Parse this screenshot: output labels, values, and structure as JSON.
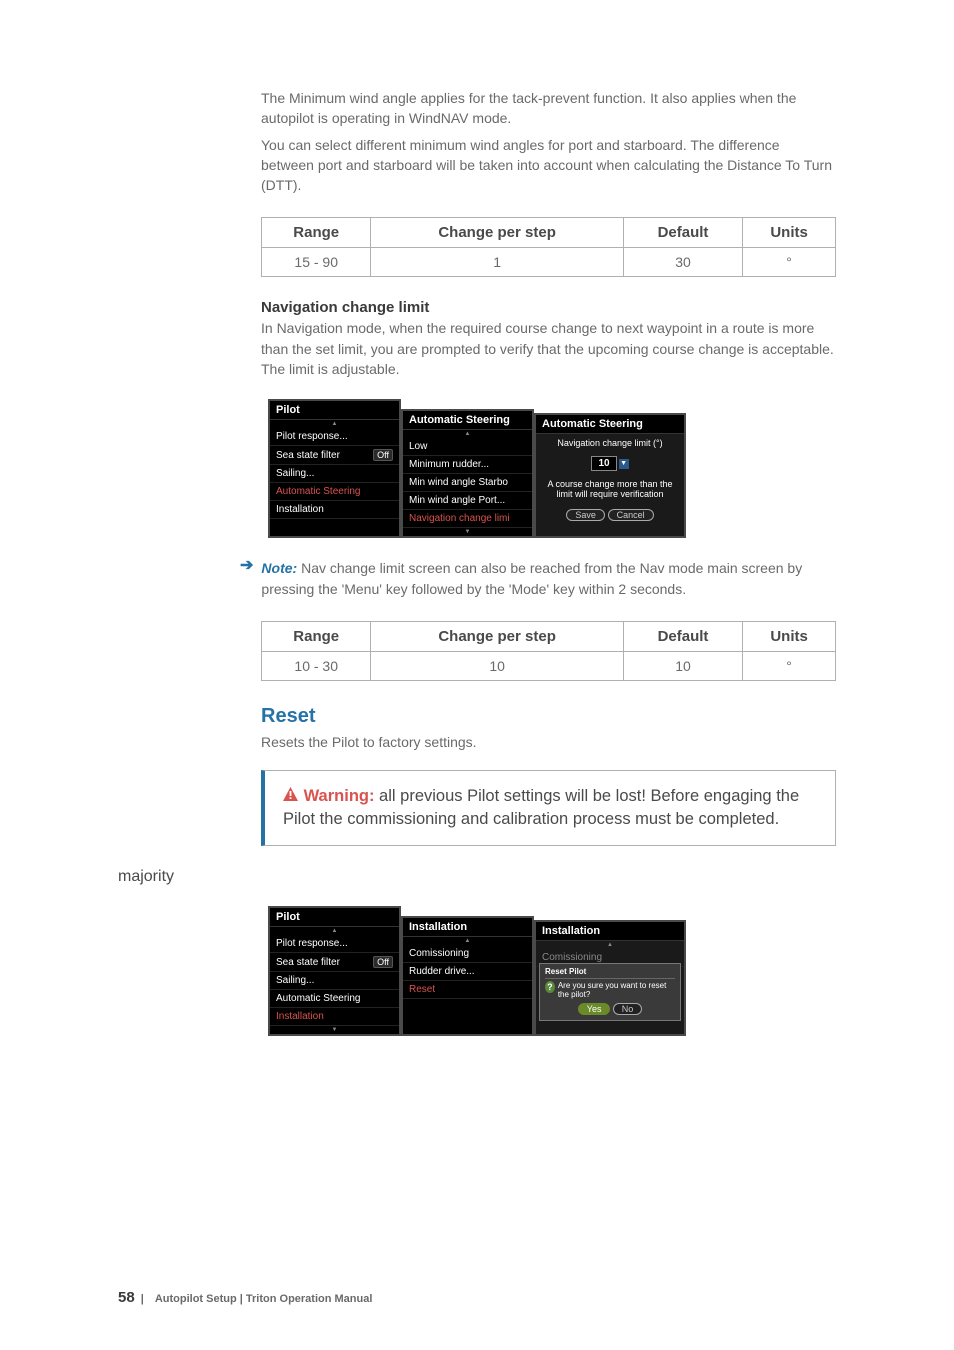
{
  "intro": {
    "p1": "The Minimum wind angle applies for the tack-prevent function. It also applies when the autopilot is operating in WindNAV mode.",
    "p2": "You can select different minimum wind angles for port and starboard. The difference between port and starboard will be taken into account when calculating the Distance To Turn (DTT)."
  },
  "table1": {
    "headers": {
      "range": "Range",
      "cps": "Change per step",
      "default": "Default",
      "units": "Units"
    },
    "row": {
      "range": "15 - 90",
      "cps": "1",
      "default": "30",
      "units": "°"
    }
  },
  "nav_limit": {
    "heading": "Navigation change limit",
    "p1": "In Navigation mode, when the required course change to next waypoint in a route is more than the set limit, you are prompted to verify that the upcoming course change is acceptable. The limit is adjustable."
  },
  "fig1": {
    "panelA": {
      "title": "Pilot",
      "items": [
        {
          "label": "Pilot response...",
          "badge": ""
        },
        {
          "label": "Sea state filter",
          "badge": "Off"
        },
        {
          "label": "Sailing...",
          "badge": ""
        },
        {
          "label": "Automatic Steering",
          "badge": "",
          "selected": true
        },
        {
          "label": "Installation",
          "badge": ""
        }
      ]
    },
    "panelB": {
      "title": "Automatic Steering",
      "items": [
        {
          "label": "Low"
        },
        {
          "label": "Minimum rudder..."
        },
        {
          "label": "Min wind angle Starbo"
        },
        {
          "label": "Min wind angle Port..."
        },
        {
          "label": "Navigation change limi",
          "selected": true
        }
      ]
    },
    "panelC": {
      "title": "Automatic Steering",
      "label": "Navigation change limit (°)",
      "value": "10",
      "hint": "A course change more than the limit will require verification",
      "save": "Save",
      "cancel": "Cancel"
    }
  },
  "note1": {
    "label": "Note:",
    "text": " Nav change limit screen can also be reached from the Nav mode main screen by pressing the 'Menu' key followed by the 'Mode' key within 2 seconds."
  },
  "table2": {
    "headers": {
      "range": "Range",
      "cps": "Change per step",
      "default": "Default",
      "units": "Units"
    },
    "row": {
      "range": "10 - 30",
      "cps": "10",
      "default": "10",
      "units": "°"
    }
  },
  "reset": {
    "heading": "Reset",
    "p1": "Resets the Pilot to factory settings."
  },
  "warning": {
    "label": "Warning:",
    "text": " all previous Pilot settings will be lost! Before engaging the Pilot the commissioning and calibration process must be completed."
  },
  "fig2": {
    "panelA": {
      "title": "Pilot",
      "items": [
        {
          "label": "Pilot response...",
          "badge": ""
        },
        {
          "label": "Sea state filter",
          "badge": "Off"
        },
        {
          "label": "Sailing...",
          "badge": ""
        },
        {
          "label": "Automatic Steering",
          "badge": ""
        },
        {
          "label": "Installation",
          "badge": "",
          "selected": true
        }
      ]
    },
    "panelB": {
      "title": "Installation",
      "items": [
        {
          "label": "Comissioning"
        },
        {
          "label": "Rudder drive..."
        },
        {
          "label": "Reset",
          "selected": true
        }
      ]
    },
    "panelC": {
      "title": "Installation",
      "subtitle": "Comissioning",
      "dialog_title": "Reset Pilot",
      "dialog_text": "Are you sure you want to reset the pilot?",
      "yes": "Yes",
      "no": "No"
    }
  },
  "footer": {
    "pagenum": "58",
    "sep": "|",
    "section": "Autopilot Setup",
    "divider": " | ",
    "manual": "Triton Operation Manual"
  }
}
